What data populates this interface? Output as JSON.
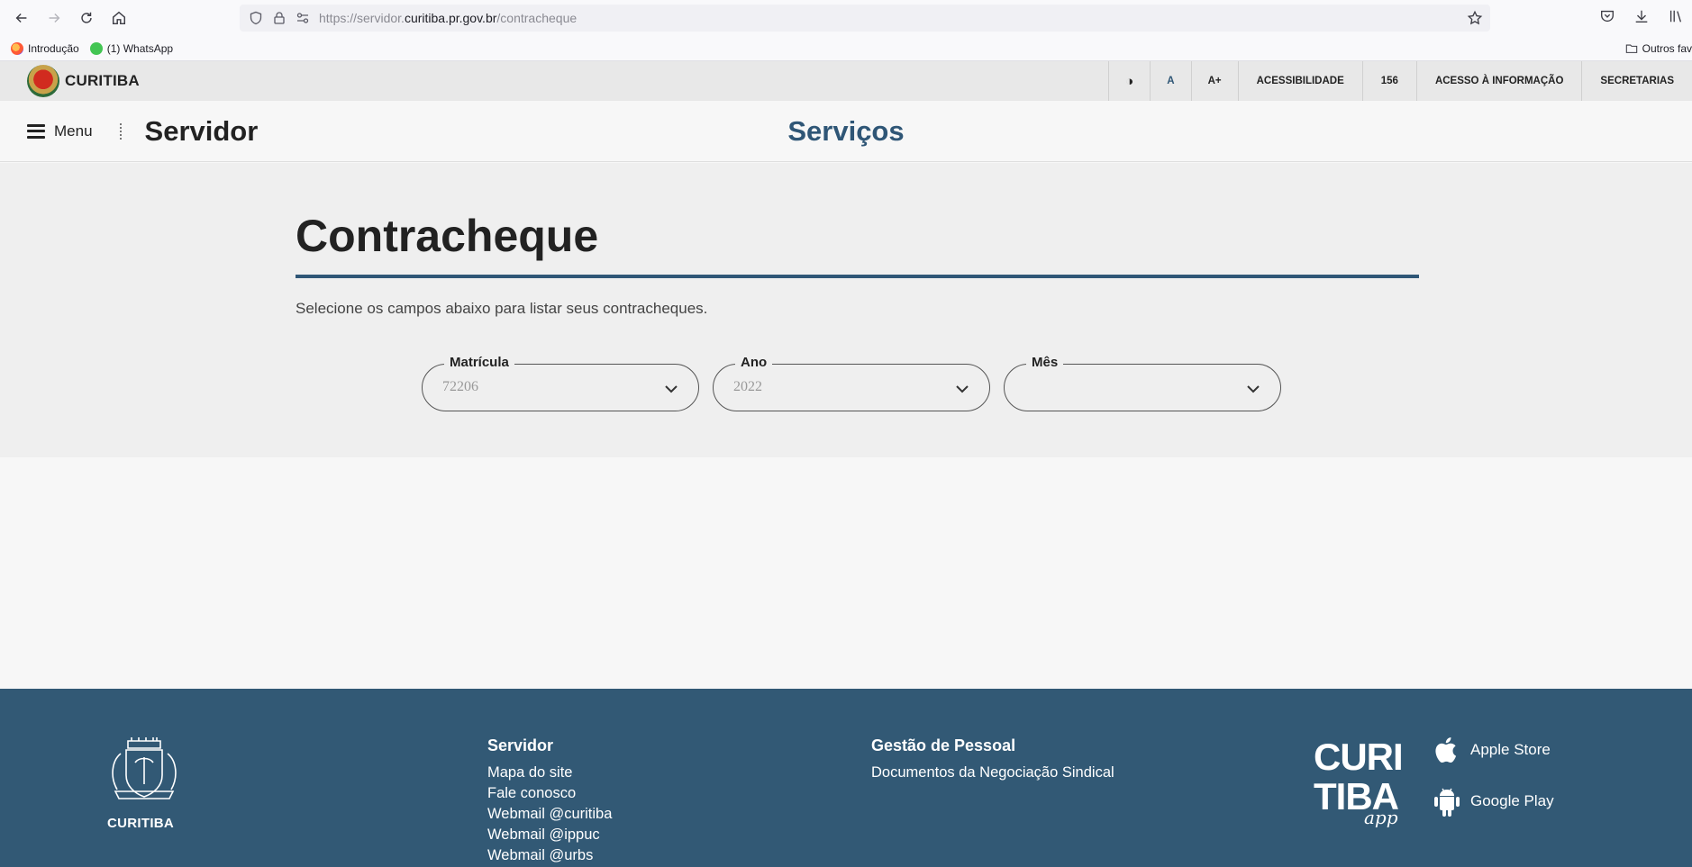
{
  "browser": {
    "url_prefix": "https://servidor.",
    "url_domain": "curitiba.pr.gov.br",
    "url_path": "/contracheque",
    "bookmarks": [
      {
        "label": "Introdução"
      },
      {
        "label": "(1) WhatsApp"
      }
    ],
    "other_bookmarks": "Outros fav"
  },
  "gov_bar": {
    "logo_text": "CURITIBA",
    "items": [
      {
        "label": "◑"
      },
      {
        "label": "A"
      },
      {
        "label": "A+"
      },
      {
        "label": "ACESSIBILIDADE"
      },
      {
        "label": "156"
      },
      {
        "label": "ACESSO À INFORMAÇÃO"
      },
      {
        "label": "SECRETARIAS"
      }
    ]
  },
  "header": {
    "menu_label": "Menu",
    "site_title": "Servidor",
    "center_title": "Serviços"
  },
  "main": {
    "title": "Contracheque",
    "instructions": "Selecione os campos abaixo para listar seus contracheques.",
    "fields": [
      {
        "label": "Matrícula",
        "value": "72206"
      },
      {
        "label": "Ano",
        "value": "2022"
      },
      {
        "label": "Mês",
        "value": ""
      }
    ]
  },
  "footer": {
    "logo_text": "CURITIBA",
    "col1": {
      "title": "Servidor",
      "links": [
        "Mapa do site",
        "Fale conosco",
        "Webmail @curitiba",
        "Webmail @ippuc",
        "Webmail @urbs"
      ]
    },
    "col2": {
      "title": "Gestão de Pessoal",
      "links": [
        "Documentos da Negociação Sindical"
      ]
    },
    "stores": {
      "apple": "Apple Store",
      "android": "Google Play"
    }
  },
  "colors": {
    "brand_blue": "#325975",
    "title_blue": "#2f5676"
  }
}
